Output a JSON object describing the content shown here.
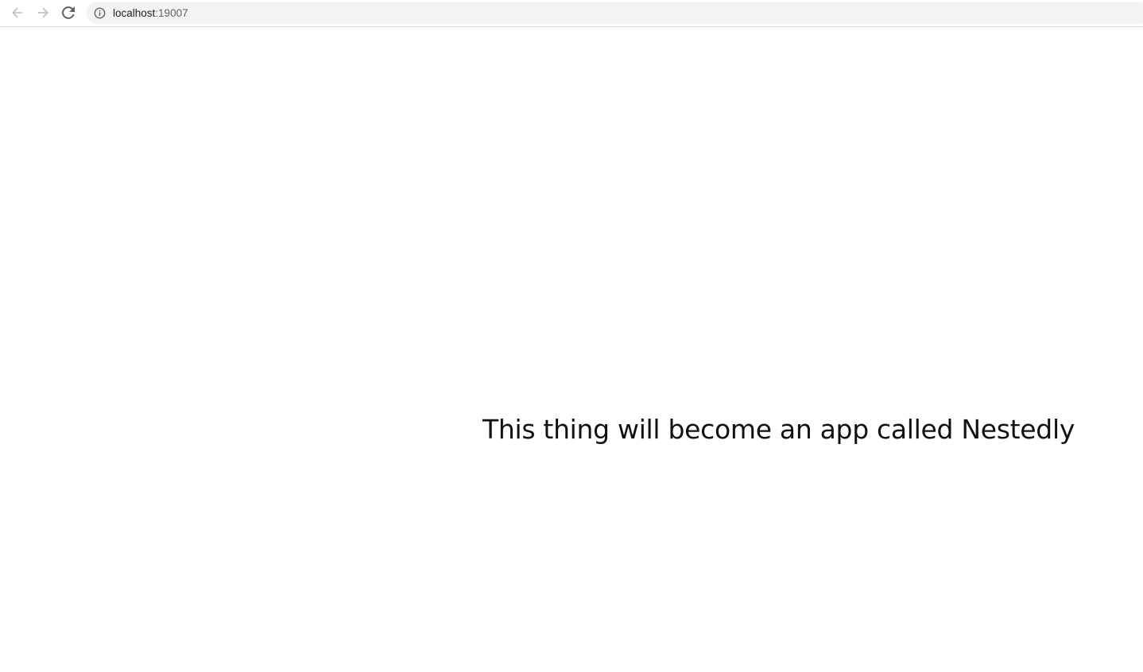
{
  "browser": {
    "url_host": "localhost",
    "url_port": ":19007",
    "icons": {
      "back": "arrow-back-icon",
      "forward": "arrow-forward-icon",
      "reload": "reload-icon",
      "info": "info-icon"
    }
  },
  "page": {
    "message": "This thing will become an app called Nestedly"
  },
  "colors": {
    "omnibox_bg": "#f1f3f4",
    "icon_disabled": "#b8bbbf",
    "icon_active": "#5f6368",
    "text": "#111111"
  }
}
